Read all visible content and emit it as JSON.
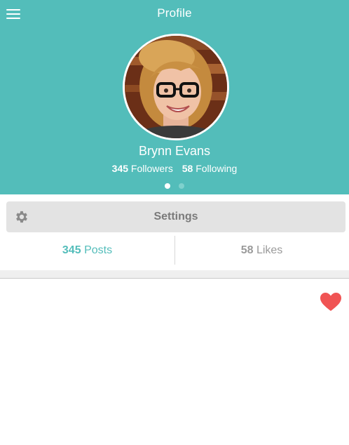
{
  "header": {
    "title": "Profile",
    "background_color": "#53bdba"
  },
  "profile": {
    "name": "Brynn Evans",
    "followers_count": "345",
    "followers_label": "Followers",
    "following_count": "58",
    "following_label": "Following"
  },
  "pager": {
    "pages": 2,
    "active_page": 1
  },
  "settings_button": {
    "label": "Settings",
    "icon": "gear-icon"
  },
  "tabs": {
    "posts": {
      "count": "345",
      "label": "Posts",
      "active": true
    },
    "likes": {
      "count": "58",
      "label": "Likes",
      "active": false
    }
  },
  "post": {
    "like_icon": "heart-icon",
    "like_color": "#f05454"
  },
  "colors": {
    "accent": "#53bdba",
    "heart": "#f05454",
    "button_bg": "#e3e3e3"
  }
}
